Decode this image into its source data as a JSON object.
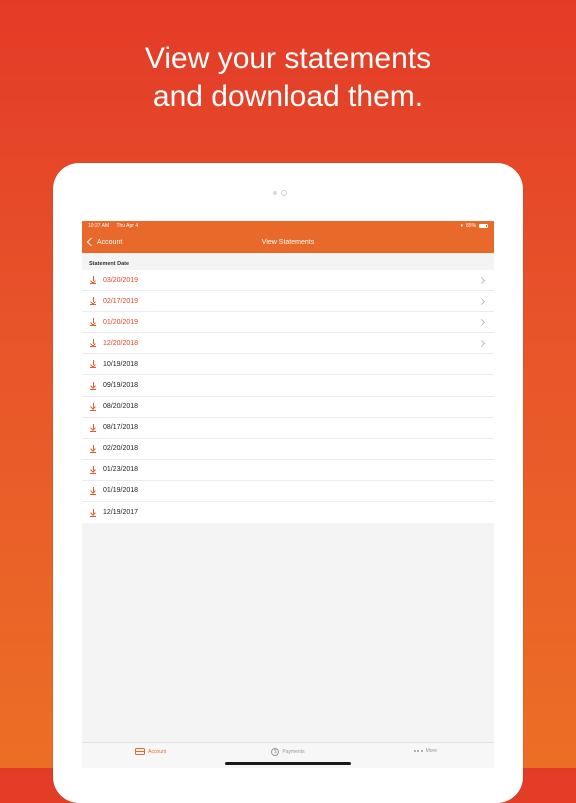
{
  "headline": {
    "line1": "View your statements",
    "line2": "and download them."
  },
  "statusbar": {
    "time": "10:27 AM",
    "date": "Thu Apr 4",
    "battery": "85%"
  },
  "navbar": {
    "back_label": "Account",
    "title": "View Statements"
  },
  "section_header": "Statement Date",
  "statements": [
    {
      "date": "03/20/2019",
      "new": true
    },
    {
      "date": "02/17/2019",
      "new": true
    },
    {
      "date": "01/20/2019",
      "new": true
    },
    {
      "date": "12/20/2018",
      "new": true
    },
    {
      "date": "10/19/2018",
      "new": false
    },
    {
      "date": "09/19/2018",
      "new": false
    },
    {
      "date": "08/20/2018",
      "new": false
    },
    {
      "date": "08/17/2018",
      "new": false
    },
    {
      "date": "02/20/2018",
      "new": false
    },
    {
      "date": "01/23/2018",
      "new": false
    },
    {
      "date": "01/19/2018",
      "new": false
    },
    {
      "date": "12/19/2017",
      "new": false
    }
  ],
  "tabs": [
    {
      "label": "Account",
      "icon": "card-icon",
      "active": true
    },
    {
      "label": "Payments",
      "icon": "dollar-icon",
      "active": false
    },
    {
      "label": "More",
      "icon": "more-icon",
      "active": false
    }
  ],
  "colors": {
    "accent": "#e9692a",
    "new_statement": "#e8432b",
    "background_top": "#e33b27",
    "background_bottom": "#ec6e25"
  }
}
